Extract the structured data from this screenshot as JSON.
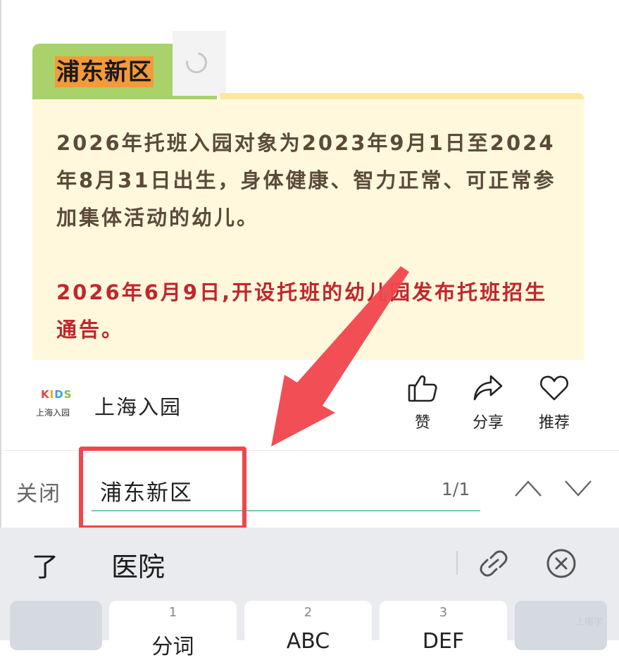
{
  "article": {
    "tab_title": "浦东新区",
    "paragraph_1": "2026年托班入园对象为2023年9月1日至2024年8月31日出生，身体健康、智力正常、可正常参加集体活动的幼儿。",
    "paragraph_2": "2026年6月9日,开设托班的幼儿园发布托班招生通告。"
  },
  "author": {
    "logo_kids": "KIDS",
    "logo_sub": "上海入园",
    "name": "上海入园"
  },
  "actions": [
    {
      "label": "赞",
      "icon": "thumbs-up-icon"
    },
    {
      "label": "分享",
      "icon": "share-icon"
    },
    {
      "label": "推荐",
      "icon": "heart-icon"
    }
  ],
  "find_bar": {
    "close_label": "关闭",
    "query": "浦东新区",
    "count": "1/1"
  },
  "keyboard": {
    "candidates": [
      "了",
      "医院"
    ],
    "keys": [
      {
        "num": "1",
        "label": "分词"
      },
      {
        "num": "2",
        "label": "ABC"
      },
      {
        "num": "3",
        "label": "DEF"
      }
    ],
    "watermark": "上哪学"
  },
  "colors": {
    "tab_green": "#a9d26a",
    "highlight_orange": "#f59a3a",
    "card_bg": "#fff8dc",
    "red_text": "#c0272d",
    "annotation_red": "#f0464c",
    "find_underline": "#7cc7a4"
  }
}
